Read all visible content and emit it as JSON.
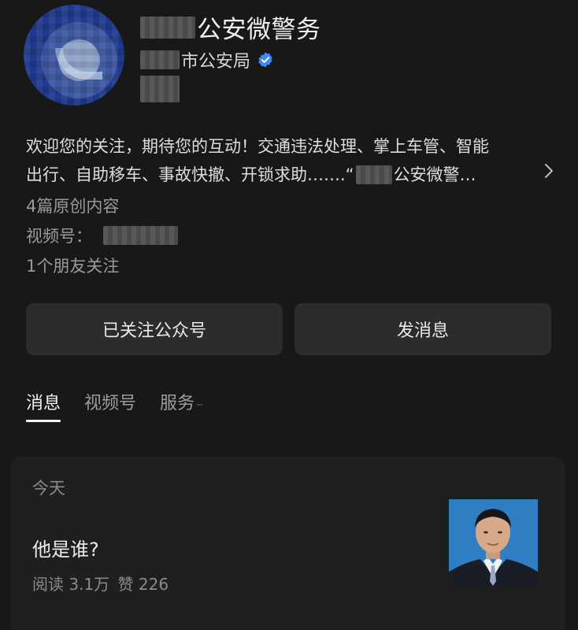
{
  "account": {
    "name": "公安微警务",
    "org": "市公安局",
    "verified_icon": "verified-badge-icon",
    "accent": "#3d8bf0"
  },
  "profile": {
    "description_line1": "欢迎您的关注，期待您的互动！交通违法处理、掌上车管、智能",
    "description_line2_before": "出行、自助移车、事故快撤、开锁求助…….“",
    "description_line2_after": "公安微警…",
    "original_count": "4篇原创内容",
    "channel_label": "视频号：",
    "friends": "1个朋友关注"
  },
  "actions": {
    "follow_label": "已关注公众号",
    "message_label": "发消息"
  },
  "tabs": [
    {
      "label": "消息",
      "active": true
    },
    {
      "label": "视频号",
      "active": false
    },
    {
      "label": "服务",
      "active": false
    }
  ],
  "feed": {
    "date": "今天",
    "article": {
      "title": "他是谁?",
      "reads": "阅读 3.1万",
      "likes": "赞 226"
    }
  }
}
